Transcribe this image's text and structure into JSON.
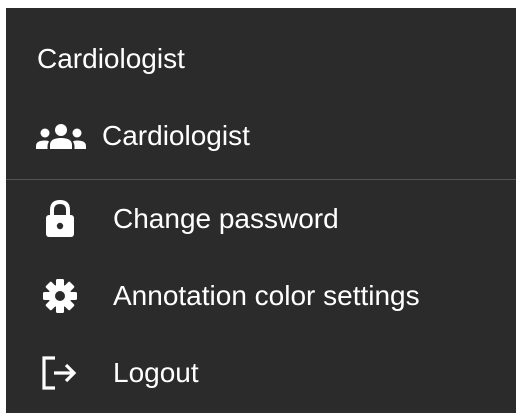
{
  "menu": {
    "user_name": "Cardiologist",
    "role": {
      "icon": "users-icon",
      "label": "Cardiologist"
    },
    "items": [
      {
        "icon": "lock-icon",
        "label": "Change password"
      },
      {
        "icon": "gear-icon",
        "label": "Annotation color settings"
      },
      {
        "icon": "logout-icon",
        "label": "Logout"
      }
    ]
  },
  "colors": {
    "background": "#2b2b2b",
    "text": "#ffffff",
    "divider": "#545454"
  }
}
